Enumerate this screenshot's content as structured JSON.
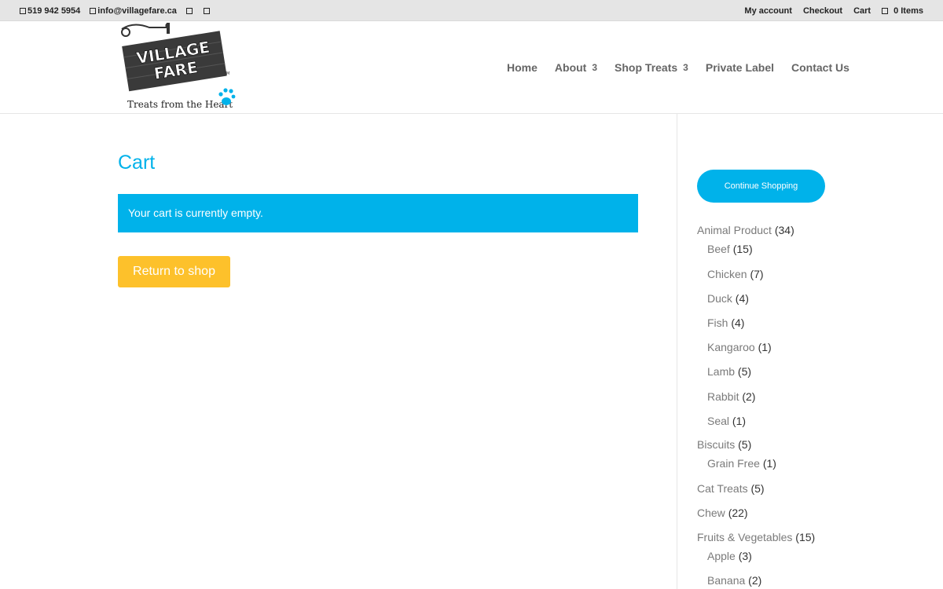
{
  "topbar": {
    "phone": "519 942 5954",
    "email": "info@villagefare.ca",
    "links": [
      "My account",
      "Checkout",
      "Cart"
    ],
    "cart_items": "0 Items"
  },
  "logo": {
    "line1": "VILLAGE",
    "line2": "FARE",
    "tagline": "Treats from the Heart",
    "tm": "TM"
  },
  "nav": {
    "items": [
      {
        "label": "Home",
        "caret": ""
      },
      {
        "label": "About",
        "caret": "3"
      },
      {
        "label": "Shop Treats",
        "caret": "3"
      },
      {
        "label": "Private Label",
        "caret": ""
      },
      {
        "label": "Contact Us",
        "caret": ""
      }
    ]
  },
  "main": {
    "title": "Cart",
    "notice": "Your cart is currently empty.",
    "return_button": "Return to shop"
  },
  "sidebar": {
    "continue_button": "Continue Shopping",
    "categories": [
      {
        "name": "Animal Product",
        "count": "(34)",
        "sub": false
      },
      {
        "name": "Beef",
        "count": "(15)",
        "sub": true
      },
      {
        "name": "Chicken",
        "count": "(7)",
        "sub": true
      },
      {
        "name": "Duck",
        "count": "(4)",
        "sub": true
      },
      {
        "name": "Fish",
        "count": "(4)",
        "sub": true
      },
      {
        "name": "Kangaroo",
        "count": "(1)",
        "sub": true
      },
      {
        "name": "Lamb",
        "count": "(5)",
        "sub": true
      },
      {
        "name": "Rabbit",
        "count": "(2)",
        "sub": true
      },
      {
        "name": "Seal",
        "count": "(1)",
        "sub": true
      },
      {
        "name": "Biscuits",
        "count": "(5)",
        "sub": false
      },
      {
        "name": "Grain Free",
        "count": "(1)",
        "sub": true
      },
      {
        "name": "Cat Treats",
        "count": "(5)",
        "sub": false
      },
      {
        "name": "Chew",
        "count": "(22)",
        "sub": false
      },
      {
        "name": "Fruits & Vegetables",
        "count": "(15)",
        "sub": false
      },
      {
        "name": "Apple",
        "count": "(3)",
        "sub": true
      },
      {
        "name": "Banana",
        "count": "(2)",
        "sub": true
      }
    ]
  },
  "colors": {
    "accent": "#00b2ea",
    "button_yellow": "#fdc12b",
    "topbar_bg": "#e5e5e5"
  }
}
